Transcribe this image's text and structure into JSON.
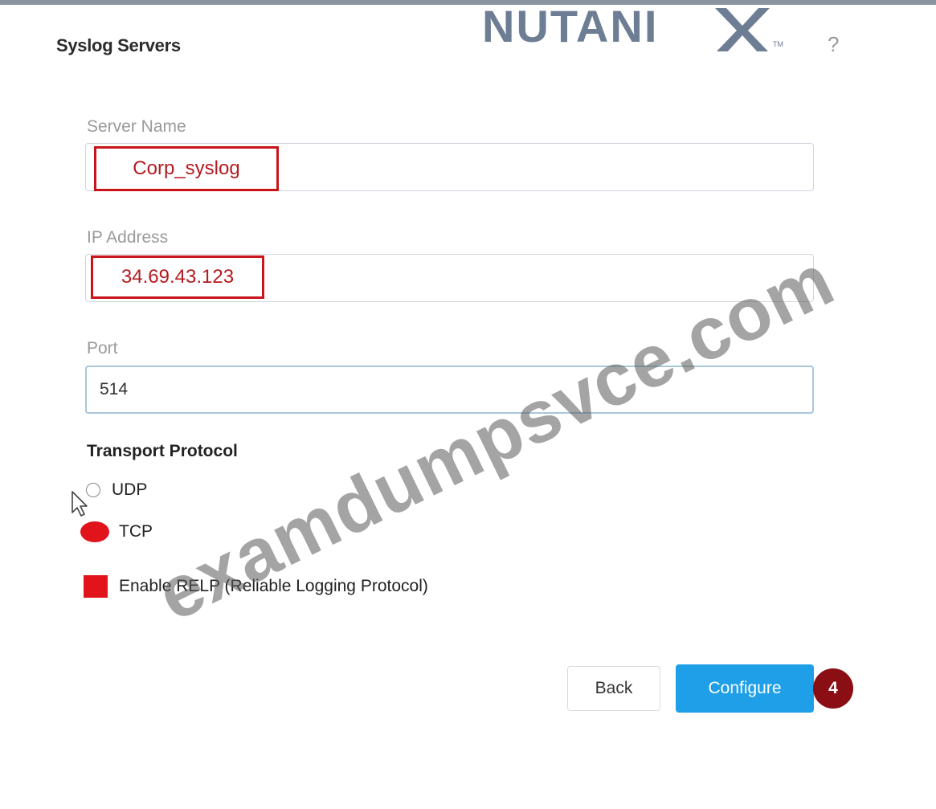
{
  "dialog": {
    "title": "Syslog Servers",
    "help_glyph": "?"
  },
  "brand": {
    "logo_text": "NUTANIX",
    "trademark": "TM",
    "color": "#6d7d94"
  },
  "form": {
    "server_name": {
      "label": "Server Name",
      "value": "Corp_syslog"
    },
    "ip_address": {
      "label": "IP Address",
      "value": "34.69.43.123"
    },
    "port": {
      "label": "Port",
      "value": "514"
    }
  },
  "transport": {
    "heading": "Transport Protocol",
    "options": [
      {
        "label": "UDP",
        "selected": false
      },
      {
        "label": "TCP",
        "selected": true
      }
    ],
    "relp_label": "Enable RELP (Reliable Logging Protocol)",
    "relp_checked": true
  },
  "actions": {
    "back_label": "Back",
    "configure_label": "Configure",
    "step_number": "4"
  },
  "watermark": "examdumpsvce.com",
  "colors": {
    "accent": "#1e9fe8",
    "highlight": "#c9141c",
    "badge": "#8b0e14"
  }
}
